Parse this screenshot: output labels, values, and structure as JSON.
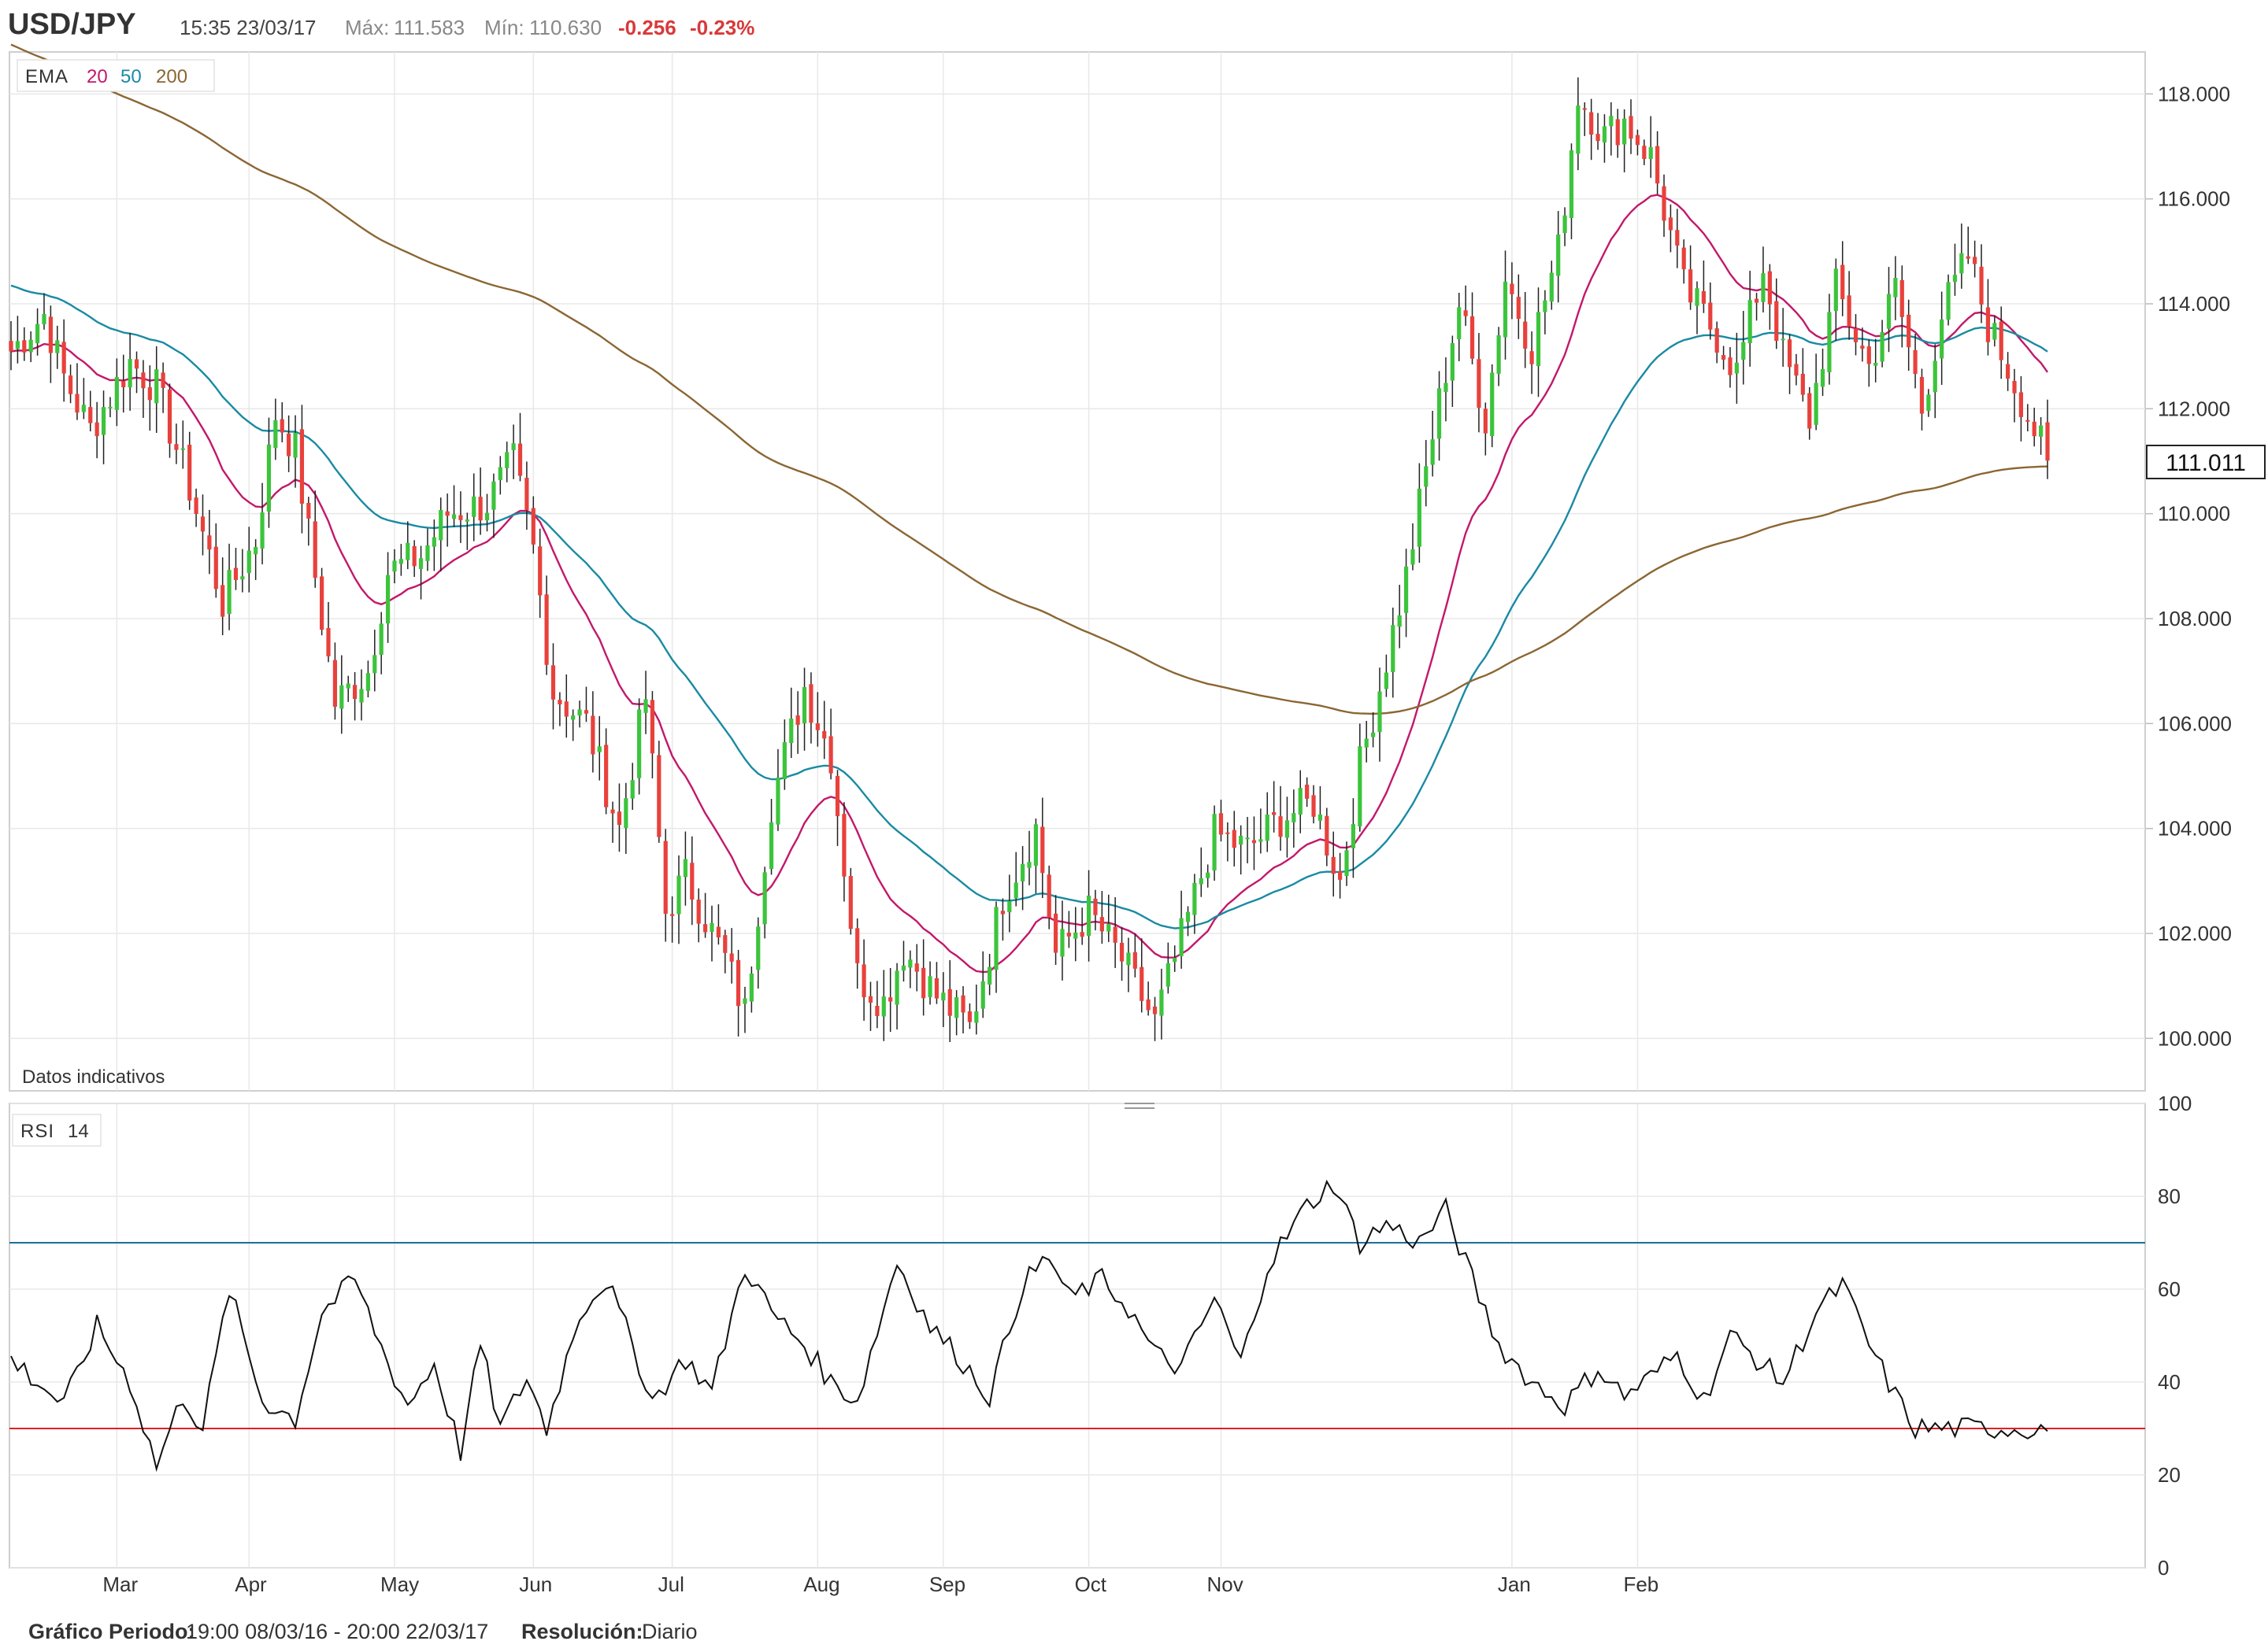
{
  "header": {
    "symbol": "USD/JPY",
    "datetime": "15:35 23/03/17",
    "max_label": "Máx:",
    "max_value": "111.583",
    "min_label": "Mín:",
    "min_value": "110.630",
    "change": "-0.256",
    "change_pct": "-0.23%",
    "change_color": "#d9393a"
  },
  "price_panel": {
    "ema_label": "EMA",
    "ema_periods": [
      "20",
      "50",
      "200"
    ],
    "ema_colors": [
      "#c2186b",
      "#1a8aa3",
      "#8b6633"
    ],
    "note": "Datos indicativos",
    "last_price": "111.011",
    "up_color": "#3cc43c",
    "down_color": "#e8413c"
  },
  "rsi_panel": {
    "label": "RSI",
    "period": "14",
    "upper_level": 70,
    "lower_level": 30,
    "upper_color": "#1b6f9a",
    "lower_color": "#e02020"
  },
  "footer": {
    "period_label": "Gráfico Periodo:",
    "period_value": "19:00 08/03/16 - 20:00 22/03/17",
    "resolution_label": "Resolución:",
    "resolution_value": "Diario"
  },
  "chart_data": [
    {
      "type": "candlestick",
      "title": "USD/JPY",
      "x_tick_labels": [
        "Mar",
        "Apr",
        "May",
        "Jun",
        "Jul",
        "Aug",
        "Sep",
        "Oct",
        "Nov",
        "Jan",
        "Feb"
      ],
      "y_tick_labels": [
        "118.000",
        "116.000",
        "114.000",
        "112.000",
        "110.000",
        "108.000",
        "106.000",
        "104.000",
        "102.000",
        "100.000"
      ],
      "ylim": [
        99.0,
        118.8
      ],
      "grid": true,
      "close_keyframes": [
        [
          0,
          113.1
        ],
        [
          5,
          113.8
        ],
        [
          8,
          112.6
        ],
        [
          12,
          111.6
        ],
        [
          18,
          112.9
        ],
        [
          22,
          112.4
        ],
        [
          27,
          110.5
        ],
        [
          32,
          108.3
        ],
        [
          37,
          109.5
        ],
        [
          40,
          111.9
        ],
        [
          43,
          111.2
        ],
        [
          49,
          106.4
        ],
        [
          54,
          107.0
        ],
        [
          57,
          108.9
        ],
        [
          62,
          109.2
        ],
        [
          66,
          110.0
        ],
        [
          72,
          110.2
        ],
        [
          76,
          111.0
        ],
        [
          79,
          109.3
        ],
        [
          82,
          106.6
        ],
        [
          87,
          106.0
        ],
        [
          92,
          104.0
        ],
        [
          96,
          106.5
        ],
        [
          99,
          102.4
        ],
        [
          102,
          103.1
        ],
        [
          108,
          101.5
        ],
        [
          111,
          100.5
        ],
        [
          115,
          104.5
        ],
        [
          120,
          106.7
        ],
        [
          124,
          105.4
        ],
        [
          128,
          101.2
        ],
        [
          132,
          100.7
        ],
        [
          135,
          101.7
        ],
        [
          140,
          100.8
        ],
        [
          145,
          100.2
        ],
        [
          150,
          102.7
        ],
        [
          155,
          104.0
        ],
        [
          158,
          101.6
        ],
        [
          163,
          102.4
        ],
        [
          168,
          101.5
        ],
        [
          173,
          100.3
        ],
        [
          178,
          102.3
        ],
        [
          182,
          103.9
        ],
        [
          187,
          103.6
        ],
        [
          192,
          104.2
        ],
        [
          197,
          104.5
        ],
        [
          201,
          103.0
        ],
        [
          204,
          105.2
        ],
        [
          207,
          106.7
        ],
        [
          211,
          108.8
        ],
        [
          215,
          111.5
        ],
        [
          219,
          114.0
        ],
        [
          223,
          111.8
        ],
        [
          226,
          114.5
        ],
        [
          230,
          113.2
        ],
        [
          234,
          115.0
        ],
        [
          237,
          118.0
        ],
        [
          241,
          117.2
        ],
        [
          244,
          117.5
        ],
        [
          248,
          116.8
        ],
        [
          253,
          114.3
        ],
        [
          258,
          113.4
        ],
        [
          261,
          112.7
        ],
        [
          265,
          114.7
        ],
        [
          268,
          113.0
        ],
        [
          272,
          111.8
        ],
        [
          276,
          114.3
        ],
        [
          281,
          112.8
        ],
        [
          285,
          114.3
        ],
        [
          289,
          112.0
        ],
        [
          292,
          113.8
        ],
        [
          296,
          114.9
        ],
        [
          299,
          113.6
        ],
        [
          303,
          112.5
        ],
        [
          308,
          111.0
        ]
      ],
      "last": 111.011,
      "ema_series": [
        {
          "name": "20",
          "color": "#c2186b"
        },
        {
          "name": "50",
          "color": "#1a8aa3"
        },
        {
          "name": "200",
          "color": "#8b6633"
        }
      ]
    },
    {
      "type": "line",
      "title": "RSI 14",
      "y_tick_labels": [
        "100",
        "80",
        "60",
        "40",
        "20",
        "0"
      ],
      "ylim": [
        0,
        100
      ],
      "reference_lines": [
        70,
        30
      ],
      "keyframes": [
        [
          0,
          45
        ],
        [
          8,
          35
        ],
        [
          13,
          52
        ],
        [
          18,
          40
        ],
        [
          22,
          22
        ],
        [
          26,
          37
        ],
        [
          29,
          30
        ],
        [
          33,
          60
        ],
        [
          38,
          36
        ],
        [
          43,
          32
        ],
        [
          47,
          55
        ],
        [
          52,
          62
        ],
        [
          57,
          44
        ],
        [
          60,
          35
        ],
        [
          64,
          44
        ],
        [
          68,
          25
        ],
        [
          71,
          48
        ],
        [
          74,
          30
        ],
        [
          78,
          41
        ],
        [
          81,
          30
        ],
        [
          86,
          55
        ],
        [
          90,
          62
        ],
        [
          94,
          48
        ],
        [
          97,
          36
        ],
        [
          102,
          45
        ],
        [
          106,
          38
        ],
        [
          111,
          65
        ],
        [
          115,
          55
        ],
        [
          120,
          48
        ],
        [
          124,
          40
        ],
        [
          128,
          36
        ],
        [
          134,
          66
        ],
        [
          139,
          52
        ],
        [
          143,
          46
        ],
        [
          148,
          37
        ],
        [
          153,
          61
        ],
        [
          157,
          67
        ],
        [
          160,
          58
        ],
        [
          165,
          62
        ],
        [
          169,
          56
        ],
        [
          173,
          46
        ],
        [
          177,
          43
        ],
        [
          182,
          58
        ],
        [
          186,
          44
        ],
        [
          190,
          65
        ],
        [
          196,
          78
        ],
        [
          200,
          83
        ],
        [
          204,
          70
        ],
        [
          208,
          74
        ],
        [
          213,
          70
        ],
        [
          217,
          77
        ],
        [
          221,
          62
        ],
        [
          225,
          48
        ],
        [
          230,
          40
        ],
        [
          235,
          35
        ],
        [
          240,
          43
        ],
        [
          244,
          37
        ],
        [
          248,
          41
        ],
        [
          252,
          46
        ],
        [
          256,
          36
        ],
        [
          260,
          50
        ],
        [
          264,
          45
        ],
        [
          268,
          40
        ],
        [
          273,
          55
        ],
        [
          277,
          61
        ],
        [
          281,
          48
        ],
        [
          285,
          37
        ],
        [
          288,
          30
        ]
      ]
    }
  ]
}
